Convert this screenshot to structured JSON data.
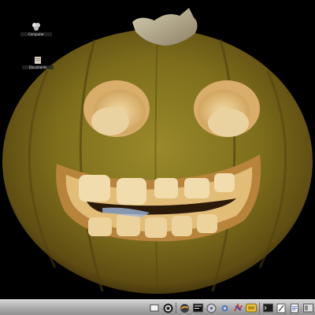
{
  "desktop": {
    "wallpaper": "carved jack-o-lantern pumpkin on black background",
    "icons": [
      {
        "label": "Computer",
        "icon": "computer-icon"
      },
      {
        "label": "Documents",
        "icon": "folder-icon"
      }
    ]
  },
  "taskbar": {
    "tray_icons": [
      "show-desktop-icon",
      "circle-app-icon",
      "browser-icon",
      "terminal-icon",
      "media-player-icon",
      "settings-icon",
      "mail-icon",
      "app-launcher-icon",
      "console-icon",
      "editor-icon",
      "document-icon",
      "file-manager-icon"
    ]
  },
  "colors": {
    "background": "#000000",
    "taskbar": "#a9a9a9",
    "pumpkin": "#8a7a1c",
    "pumpkin_inner": "#e8c88a"
  }
}
